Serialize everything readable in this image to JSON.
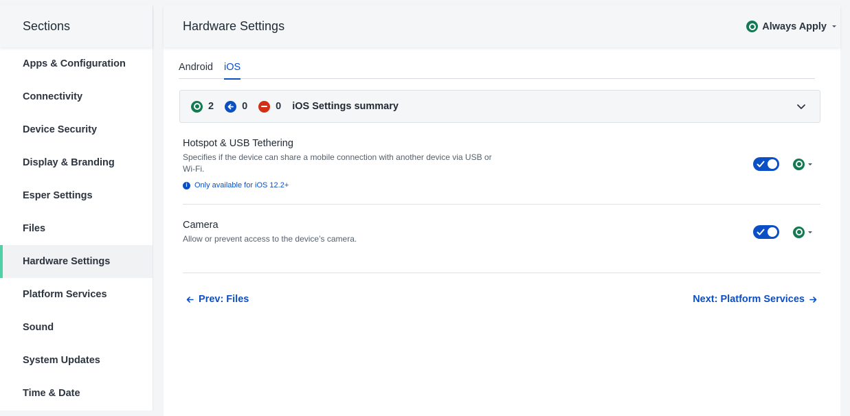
{
  "sidebar": {
    "title": "Sections",
    "items": [
      {
        "label": "Apps & Configuration"
      },
      {
        "label": "Connectivity"
      },
      {
        "label": "Device Security"
      },
      {
        "label": "Display & Branding"
      },
      {
        "label": "Esper Settings"
      },
      {
        "label": "Files"
      },
      {
        "label": "Hardware Settings",
        "active": true
      },
      {
        "label": "Platform Services"
      },
      {
        "label": "Sound"
      },
      {
        "label": "System Updates"
      },
      {
        "label": "Time & Date"
      }
    ]
  },
  "header": {
    "title": "Hardware Settings",
    "apply_label": "Always Apply",
    "apply_icon": "always-apply-icon"
  },
  "tabs": [
    {
      "label": "Android",
      "active": false
    },
    {
      "label": "iOS",
      "active": true
    }
  ],
  "summary": {
    "apply_count": "2",
    "inherit_count": "0",
    "disabled_count": "0",
    "title": "iOS Settings summary"
  },
  "settings": [
    {
      "title": "Hotspot & USB Tethering",
      "description": "Specifies if the device can share a mobile connection with another device via USB or Wi-Fi.",
      "note": "Only available for iOS 12.2+",
      "enabled": true
    },
    {
      "title": "Camera",
      "description": "Allow or prevent access to the device’s camera.",
      "enabled": true
    }
  ],
  "footer": {
    "prev_label": "Prev: Files",
    "next_label": "Next: Platform Services"
  },
  "colors": {
    "accent_blue": "#0b4fc4",
    "apply_green": "#137a52",
    "error_red": "#d12f16",
    "active_indicator": "#4fd1a5"
  }
}
